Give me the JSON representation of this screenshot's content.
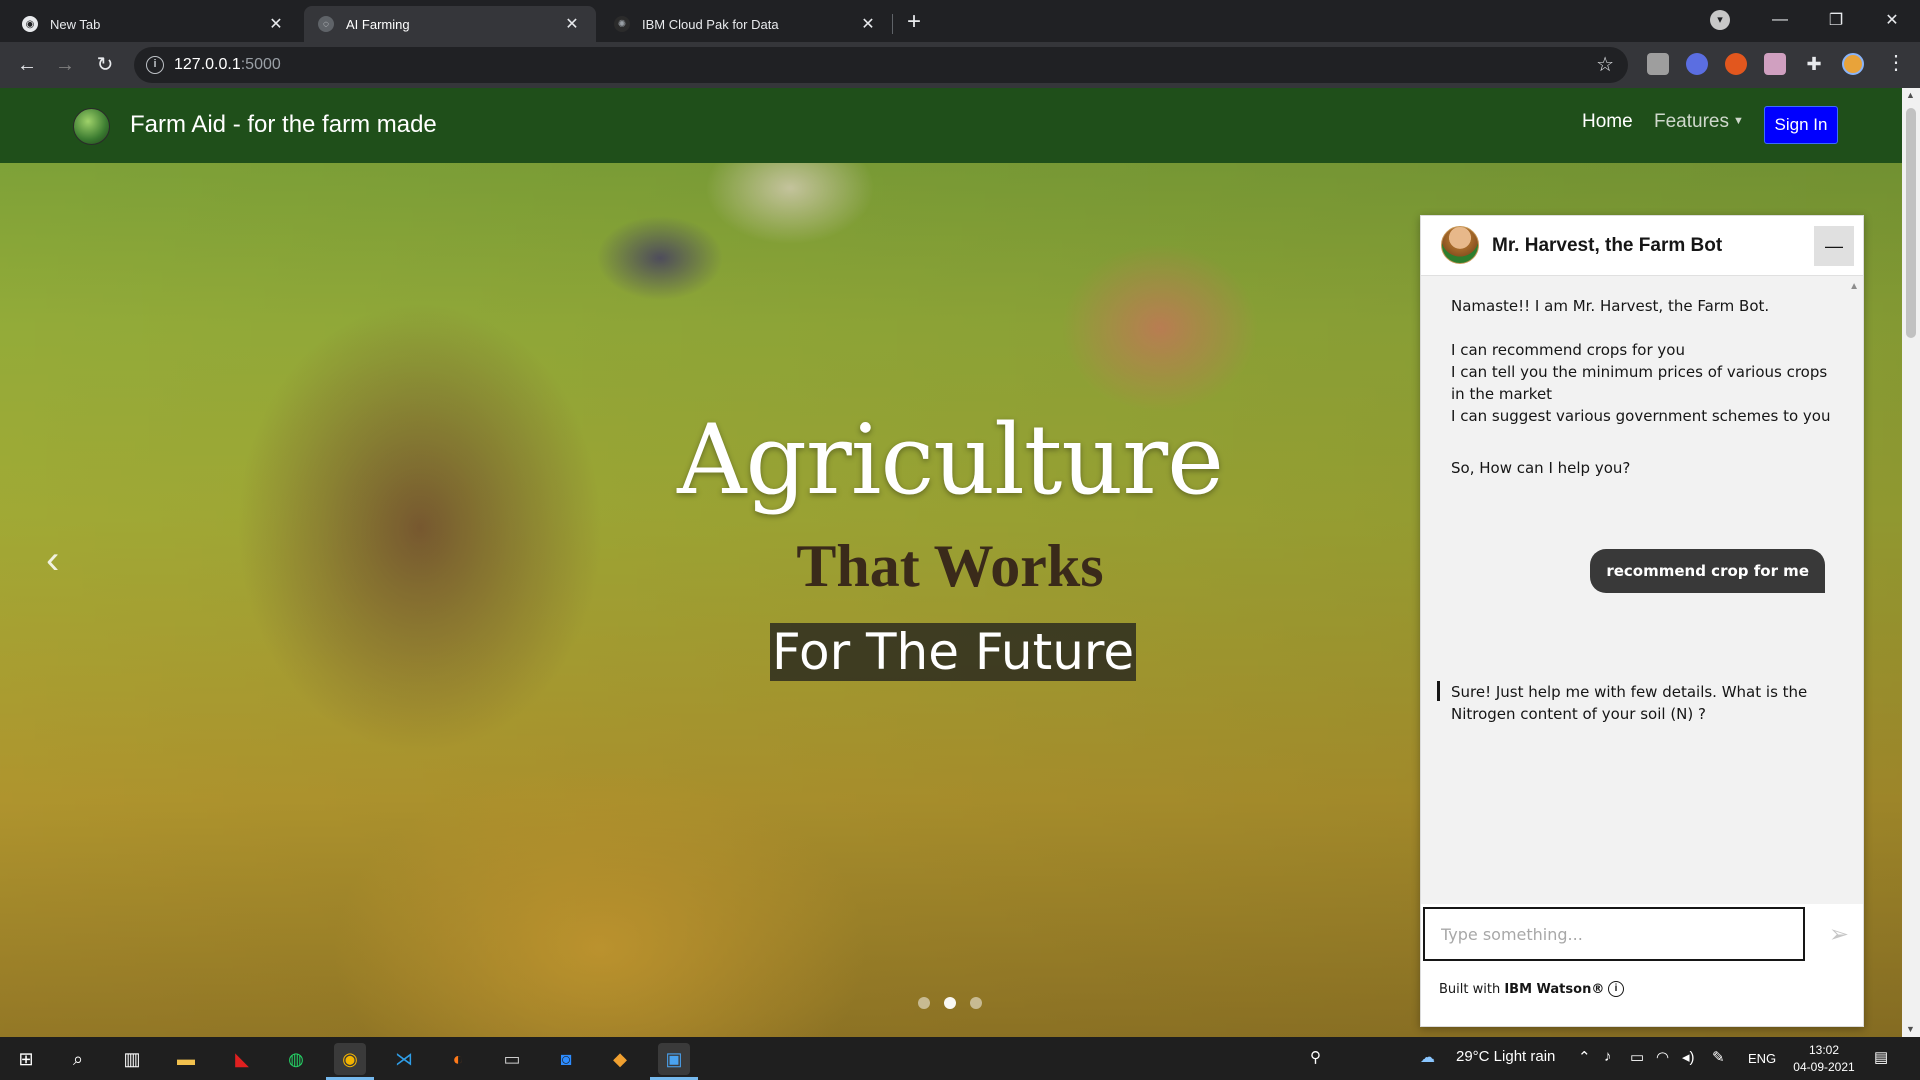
{
  "browser": {
    "tabs": [
      {
        "title": "New Tab",
        "active": false
      },
      {
        "title": "AI Farming",
        "active": true
      },
      {
        "title": "IBM Cloud Pak for Data",
        "active": false
      }
    ],
    "url_host": "127.0.0.1",
    "url_port": ":5000"
  },
  "site": {
    "brand": "Farm Aid - for the farm made",
    "nav": {
      "home": "Home",
      "features": "Features",
      "signin": "Sign In"
    }
  },
  "hero": {
    "title": "Agriculture",
    "subtitle1": "That Works",
    "subtitle2": "For The Future",
    "carousel_slides": 3,
    "active_slide": 1
  },
  "chat": {
    "bot_name": "Mr. Harvest, the Farm Bot",
    "messages": [
      {
        "from": "bot",
        "text": "Namaste!! I am Mr. Harvest, the Farm Bot.\n\nI can recommend crops for you\nI can tell you the minimum prices of various crops in the market\nI can suggest various government schemes to you"
      },
      {
        "from": "bot",
        "text": "So, How can I help you?"
      },
      {
        "from": "user",
        "text": "recommend crop for me"
      },
      {
        "from": "bot",
        "text": "Sure! Just help me with few details. What is the Nitrogen content of your soil (N) ?"
      }
    ],
    "input_placeholder": "Type something...",
    "built_with_prefix": "Built with ",
    "built_with_brand": "IBM Watson®"
  },
  "taskbar": {
    "weather": "29°C  Light rain",
    "lang": "ENG",
    "time": "13:02",
    "date": "04-09-2021"
  }
}
